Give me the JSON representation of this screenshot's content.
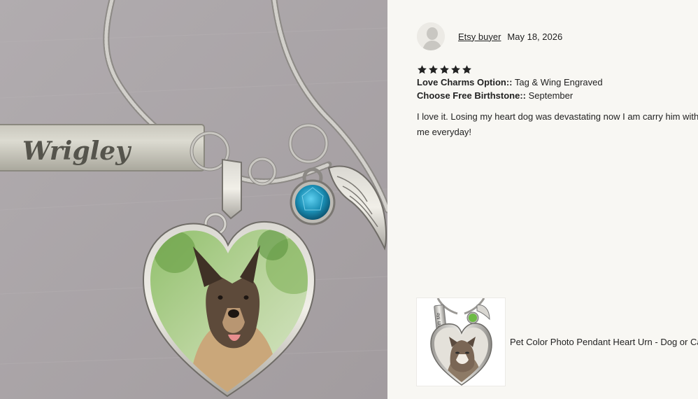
{
  "photo": {
    "tag_engraving": "Wrigley"
  },
  "review": {
    "reviewer_name": "Etsy buyer",
    "date": "May 18, 2026",
    "rating": 5,
    "rating_max": 5,
    "attributes": [
      {
        "key": "Love Charms Option::",
        "value": " Tag & Wing Engraved"
      },
      {
        "key": "Choose Free Birthstone::",
        "value": " September"
      }
    ],
    "text": "I love it. Losing my heart dog was devastating now I am carry him with me everyday!"
  },
  "product": {
    "title": "Pet Color Photo Pendant Heart Urn - Dog or Cat -",
    "thumb_engraving": "Forever With Me"
  },
  "colors": {
    "star": "#222222",
    "birthstone": "#1b8fb5",
    "product_stone": "#6dbb45"
  }
}
